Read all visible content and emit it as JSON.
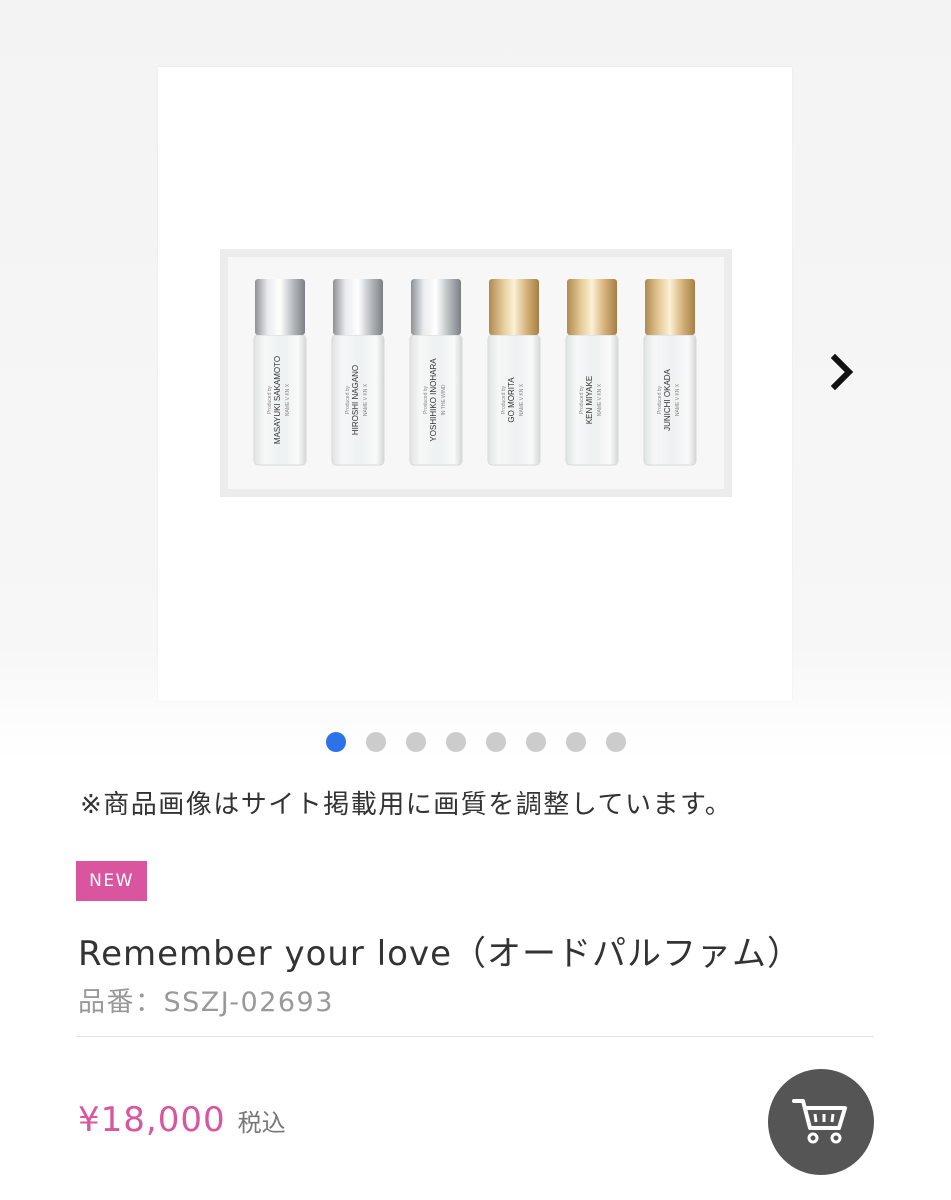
{
  "gallery": {
    "product_image": {
      "bottles": [
        {
          "cap": "silver",
          "producer": "Produced by",
          "name": "MASAYUKI SAKAMOTO",
          "sub": "NAME V KN X"
        },
        {
          "cap": "silver",
          "producer": "Produced by",
          "name": "HIROSHI NAGANO",
          "sub": "NAME V KN X"
        },
        {
          "cap": "silver",
          "producer": "Produced by",
          "name": "YOSHIHIKO INOHARA",
          "sub": "IN THE WIND"
        },
        {
          "cap": "gold",
          "producer": "Produced by",
          "name": "GO MORITA",
          "sub": "NAME V KN X"
        },
        {
          "cap": "gold",
          "producer": "Produced by",
          "name": "KEN MIYAKE",
          "sub": "NAME V KN X"
        },
        {
          "cap": "gold",
          "producer": "Produced by",
          "name": "JUNICHI OKADA",
          "sub": "NAME V KN X"
        }
      ]
    },
    "next_icon": "chevron-right-icon",
    "dot_count": 8,
    "active_dot": 0
  },
  "notice": "※商品画像はサイト掲載用に画質を調整しています。",
  "product": {
    "badge": "NEW",
    "title": "Remember your love（オードパルファム）",
    "sku": "品番：SSZJ-02693",
    "price": "¥18,000",
    "tax_label": "税込"
  },
  "cart": {
    "icon": "cart-icon"
  },
  "colors": {
    "accent_pink": "#d9559f",
    "active_dot": "#2d72e8",
    "inactive_dot": "#cccccc",
    "cart_button": "#555555"
  }
}
